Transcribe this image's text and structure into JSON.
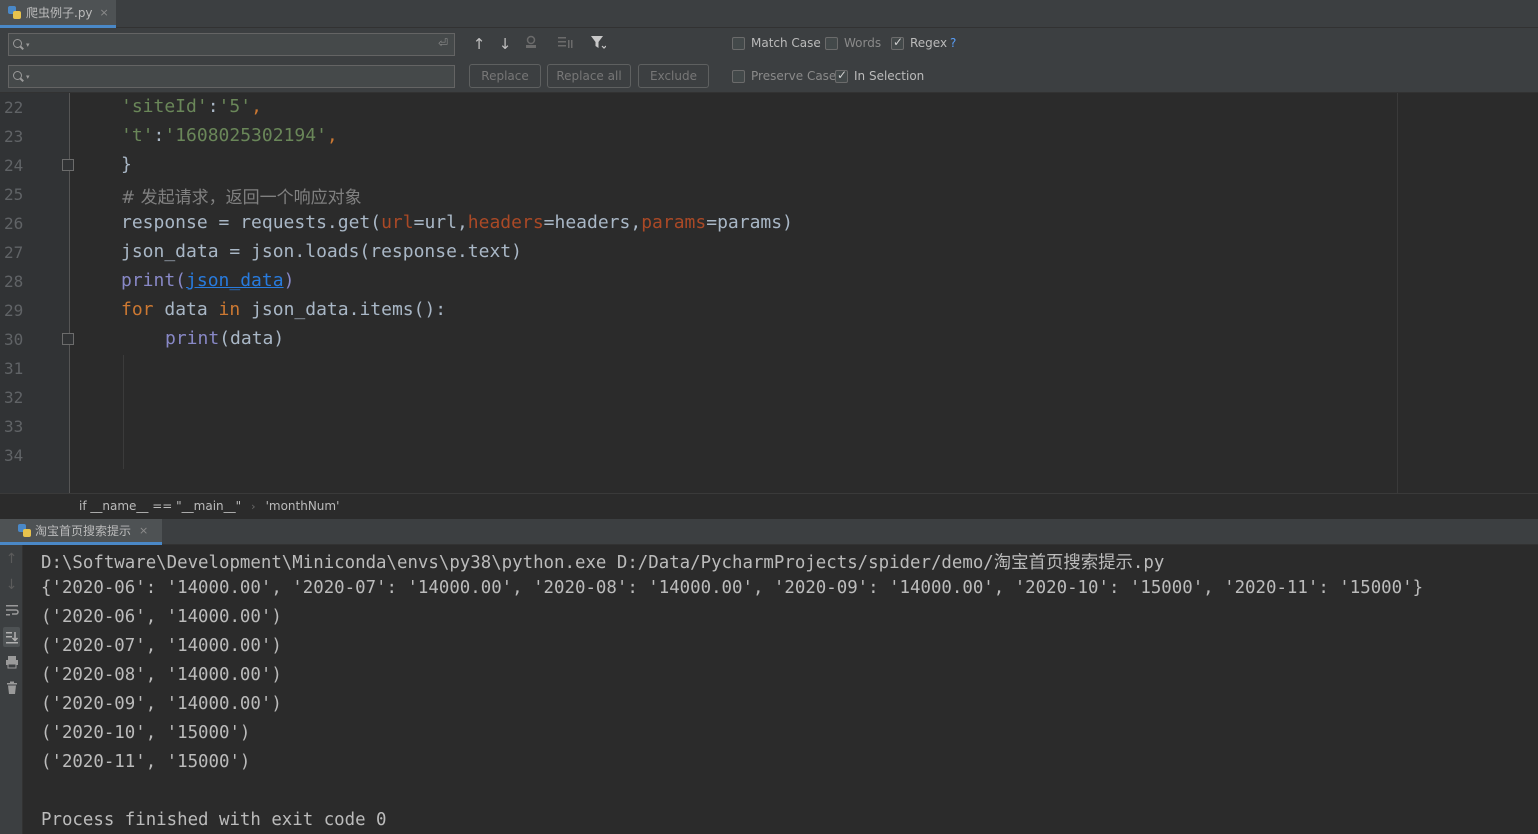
{
  "editor_tab": {
    "filename": "爬虫例子.py",
    "close": "×"
  },
  "find": {
    "search_value": "",
    "replace_value": "",
    "options": {
      "match_case": {
        "label": "Match Case",
        "checked": false
      },
      "words": {
        "label": "Words",
        "checked": false
      },
      "regex": {
        "label": "Regex",
        "checked": true
      },
      "preserve_case": {
        "label": "Preserve Case",
        "checked": false
      },
      "in_selection": {
        "label": "In Selection",
        "checked": true
      }
    },
    "help": "?",
    "buttons": {
      "replace": "Replace",
      "replace_all": "Replace all",
      "exclude": "Exclude"
    },
    "icons": {
      "prev": "↑",
      "next": "↓",
      "select_all": "select-all-occurrences-icon",
      "filter_search": "filter-search-icon",
      "filter": "filter-icon",
      "newline": "⏎"
    }
  },
  "code": {
    "line_numbers": [
      "22",
      "23",
      "24",
      "25",
      "26",
      "27",
      "28",
      "29",
      "30",
      "31",
      "32",
      "33",
      "34"
    ],
    "line22": {
      "key": "'siteId'",
      "colon": ":",
      "val": "'5'",
      "comma": ","
    },
    "line23": {
      "key": "'t'",
      "colon": ":",
      "val": "'1608025302194'",
      "comma": ","
    },
    "line24": "}",
    "line25": "# 发起请求，返回一个响应对象",
    "line26": {
      "a": "response = requests.get(",
      "p1": "url",
      "b": "=url,",
      "p2": "headers",
      "c": "=headers,",
      "p3": "params",
      "d": "=params)"
    },
    "line27": "json_data = json.loads(response.text)",
    "line28": {
      "fn": "print(",
      "arg": "json_data",
      "end": ")"
    },
    "line29": {
      "kw1": "for",
      "a": " data ",
      "kw2": "in",
      "b": " json_data.items():"
    },
    "line30": {
      "fn": "print",
      "rest": "(data)"
    }
  },
  "breadcrumb": {
    "item1": "if __name__ == \"__main__\"",
    "sep": "›",
    "item2": "'monthNum'"
  },
  "run_tab": {
    "label": "淘宝首页搜索提示",
    "close": "×"
  },
  "console": {
    "lines": [
      "D:\\Software\\Development\\Miniconda\\envs\\py38\\python.exe D:/Data/PycharmProjects/spider/demo/淘宝首页搜索提示.py",
      "{'2020-06': '14000.00', '2020-07': '14000.00', '2020-08': '14000.00', '2020-09': '14000.00', '2020-10': '15000', '2020-11': '15000'}",
      "('2020-06', '14000.00')",
      "('2020-07', '14000.00')",
      "('2020-08', '14000.00')",
      "('2020-09', '14000.00')",
      "('2020-10', '15000')",
      "('2020-11', '15000')",
      "",
      "Process finished with exit code 0"
    ]
  },
  "colors": {
    "string": "#6a8759",
    "keyword": "#cc7832",
    "param": "#aa4926",
    "builtin": "#8888c6",
    "comment": "#808080",
    "accent": "#4a88c7"
  }
}
